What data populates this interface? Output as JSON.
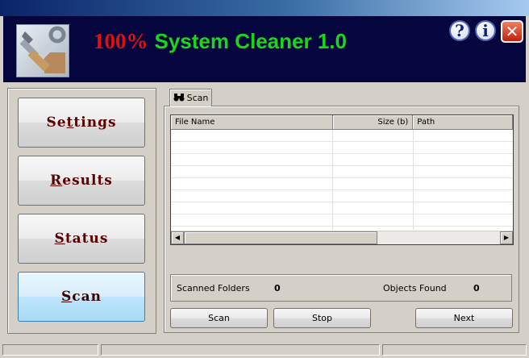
{
  "header": {
    "title_pct": "100%",
    "title_name": "System Cleaner 1.0",
    "help_glyph": "?",
    "info_glyph": "i",
    "close_glyph": "✕",
    "logo_icon": "tools-icon"
  },
  "sidebar": {
    "items": [
      {
        "pre": "Se",
        "u": "t",
        "post": "tings"
      },
      {
        "pre": "",
        "u": "R",
        "post": "esults"
      },
      {
        "pre": "",
        "u": "S",
        "post": "tatus"
      },
      {
        "pre": "",
        "u": "S",
        "post": "can"
      }
    ],
    "active_index": 3
  },
  "tab": {
    "label": "Scan",
    "icon": "binoculars-icon"
  },
  "table": {
    "columns": [
      "File Name",
      "Size (b)",
      "Path"
    ],
    "rows": []
  },
  "stats": {
    "scanned_label": "Scanned Folders",
    "scanned_value": "0",
    "found_label": "Objects Found",
    "found_value": "0"
  },
  "buttons": {
    "scan": "Scan",
    "stop": "Stop",
    "next": "Next"
  },
  "colors": {
    "accent_red": "#e01010",
    "accent_green": "#19d819",
    "header_bg": "#06063f"
  }
}
